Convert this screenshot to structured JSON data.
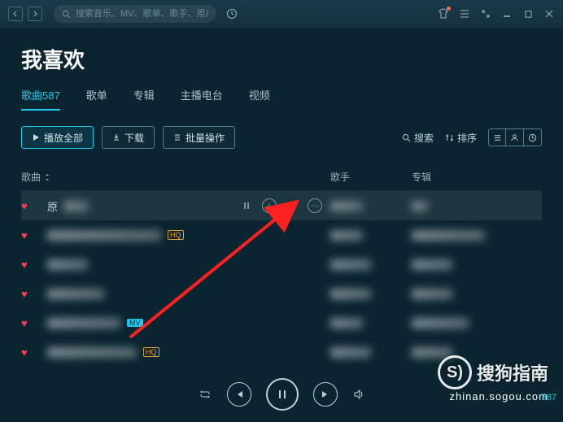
{
  "titlebar": {
    "search_placeholder": "搜索音乐、MV、歌单、歌手、用户"
  },
  "page": {
    "title": "我喜欢"
  },
  "tabs": [
    {
      "label": "歌曲587",
      "active": true
    },
    {
      "label": "歌单",
      "active": false
    },
    {
      "label": "专辑",
      "active": false
    },
    {
      "label": "主播电台",
      "active": false
    },
    {
      "label": "视频",
      "active": false
    }
  ],
  "toolbar": {
    "play_all": "播放全部",
    "download": "下载",
    "batch": "批量操作",
    "search": "搜索",
    "sort": "排序"
  },
  "columns": {
    "song": "歌曲",
    "artist": "歌手",
    "album": "专辑"
  },
  "rows": [
    {
      "name": "原",
      "active": true
    },
    {
      "name": "",
      "active": false
    },
    {
      "name": "",
      "active": false
    },
    {
      "name": "",
      "active": false
    },
    {
      "name": "",
      "active": false
    },
    {
      "name": "",
      "active": false
    }
  ],
  "watermark": {
    "brand": "搜狗指南",
    "url": "zhinan.sogou.com",
    "count": "587"
  }
}
